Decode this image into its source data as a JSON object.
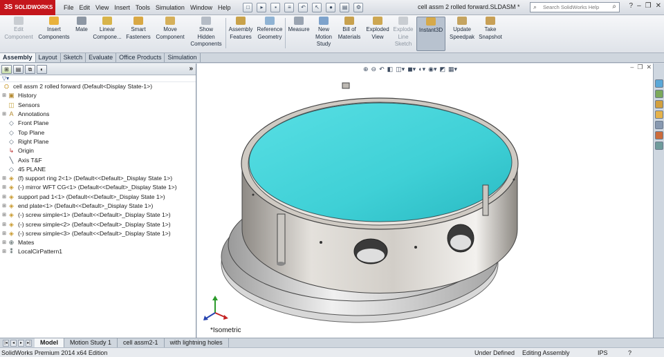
{
  "app": {
    "logo": "SOLIDWORKS",
    "doc_title": "cell assm 2 rolled forward.SLDASM *",
    "search_placeholder": "Search SolidWorks Help"
  },
  "menus": [
    "File",
    "Edit",
    "View",
    "Insert",
    "Tools",
    "Simulation",
    "Window",
    "Help"
  ],
  "commands": [
    {
      "label": "Edit\nComponent",
      "icon": "edit-component-icon",
      "disabled": true
    },
    {
      "label": "Insert\nComponents",
      "icon": "insert-components-icon"
    },
    {
      "label": "Mate",
      "icon": "mate-icon"
    },
    {
      "label": "Linear\nCompone...",
      "icon": "linear-pattern-icon"
    },
    {
      "label": "Smart\nFasteners",
      "icon": "smart-fasteners-icon"
    },
    {
      "label": "Move\nComponent",
      "icon": "move-component-icon"
    },
    {
      "label": "Show\nHidden\nComponents",
      "icon": "show-hidden-icon"
    },
    {
      "label": "Assembly\nFeatures",
      "icon": "assembly-features-icon"
    },
    {
      "label": "Reference\nGeometry",
      "icon": "reference-geometry-icon"
    },
    {
      "label": "Measure",
      "icon": "measure-icon"
    },
    {
      "label": "New\nMotion\nStudy",
      "icon": "motion-study-icon"
    },
    {
      "label": "Bill of\nMaterials",
      "icon": "bom-icon"
    },
    {
      "label": "Exploded\nView",
      "icon": "exploded-view-icon"
    },
    {
      "label": "Explode\nLine\nSketch",
      "icon": "explode-line-icon",
      "disabled": true
    },
    {
      "label": "Instant3D",
      "icon": "instant3d-icon",
      "active": true
    },
    {
      "label": "Update\nSpeedpak",
      "icon": "speedpak-icon"
    },
    {
      "label": "Take\nSnapshot",
      "icon": "snapshot-icon"
    }
  ],
  "tabs": [
    "Assembly",
    "Layout",
    "Sketch",
    "Evaluate",
    "Office Products",
    "Simulation"
  ],
  "tree": {
    "root": "cell assm 2 rolled forward  (Default<Display State-1>)",
    "items": [
      {
        "label": "History",
        "icon": "history-icon",
        "expand": true
      },
      {
        "label": "Sensors",
        "icon": "sensors-icon",
        "expand": false
      },
      {
        "label": "Annotations",
        "icon": "annotations-icon",
        "expand": true
      },
      {
        "label": "Front Plane",
        "icon": "plane-icon",
        "expand": false
      },
      {
        "label": "Top Plane",
        "icon": "plane-icon",
        "expand": false
      },
      {
        "label": "Right Plane",
        "icon": "plane-icon",
        "expand": false
      },
      {
        "label": "Origin",
        "icon": "origin-icon",
        "expand": false
      },
      {
        "label": "Axis T&F",
        "icon": "axis-icon",
        "expand": false
      },
      {
        "label": "45 PLANE",
        "icon": "plane-icon",
        "expand": false
      },
      {
        "label": "(f) support ring 2<1> (Default<<Default>_Display State 1>)",
        "icon": "part-icon",
        "expand": true
      },
      {
        "label": "(-) mirror WFT CG<1> (Default<<Default>_Display State 1>)",
        "icon": "part-icon",
        "expand": true
      },
      {
        "label": "support pad 1<1> (Default<<Default>_Display State 1>)",
        "icon": "part-icon",
        "expand": true
      },
      {
        "label": "end plate<1> (Default<<Default>_Display State 1>)",
        "icon": "part-icon",
        "expand": true
      },
      {
        "label": "(-) screw simple<1> (Default<<Default>_Display State 1>)",
        "icon": "part-icon",
        "expand": true
      },
      {
        "label": "(-) screw simple<2> (Default<<Default>_Display State 1>)",
        "icon": "part-icon",
        "expand": true
      },
      {
        "label": "(-) screw simple<3> (Default<<Default>_Display State 1>)",
        "icon": "part-icon",
        "expand": true
      },
      {
        "label": "Mates",
        "icon": "mates-icon",
        "expand": true
      },
      {
        "label": "LocalCirPattern1",
        "icon": "pattern-icon",
        "expand": true
      }
    ]
  },
  "viewport": {
    "orientation": "*Isometric"
  },
  "bottom_tabs": [
    "Model",
    "Motion Study 1",
    "cell assm2-1",
    "with lightning holes"
  ],
  "status": {
    "edition": "SolidWorks Premium 2014 x64 Edition",
    "defined": "Under Defined",
    "mode": "Editing Assembly",
    "units": "IPS"
  },
  "colors": {
    "mirror": "#3fd0d6",
    "body": "#d9d5cf",
    "brand": "#c4161c"
  }
}
